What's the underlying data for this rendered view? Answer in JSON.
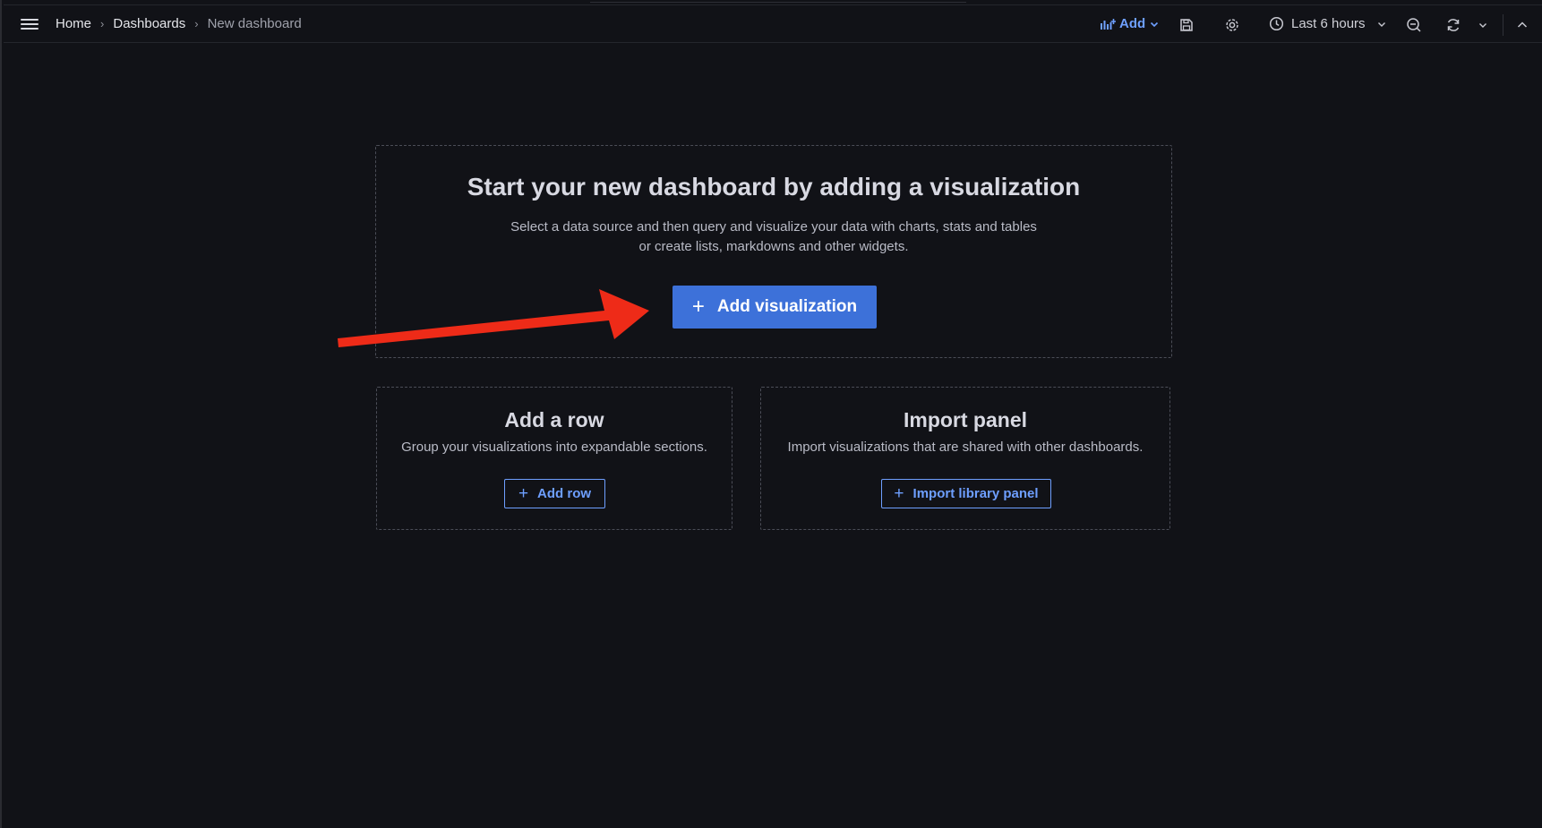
{
  "breadcrumbs": [
    "Home",
    "Dashboards",
    "New dashboard"
  ],
  "toolbar": {
    "add_label": "Add",
    "time_range": "Last 6 hours"
  },
  "main": {
    "title": "Start your new dashboard by adding a visualization",
    "description_line1": "Select a data source and then query and visualize your data with charts, stats and tables",
    "description_line2": "or create lists, markdowns and other widgets.",
    "primary_button": "Add visualization"
  },
  "cards": {
    "row": {
      "title": "Add a row",
      "description": "Group your visualizations into expandable sections.",
      "button": "Add row"
    },
    "import": {
      "title": "Import panel",
      "description": "Import visualizations that are shared with other dashboards.",
      "button": "Import library panel"
    }
  },
  "colors": {
    "background": "#111217",
    "primary": "#3d71d9",
    "link_blue": "#6e9fff",
    "annotation_arrow": "#ee2b18"
  },
  "icons": [
    "menu-icon",
    "bar-chart-plus-icon",
    "chevron-down-icon",
    "save-icon",
    "gear-icon",
    "clock-icon",
    "zoom-out-icon",
    "refresh-icon",
    "chevron-up-icon",
    "plus-icon"
  ]
}
